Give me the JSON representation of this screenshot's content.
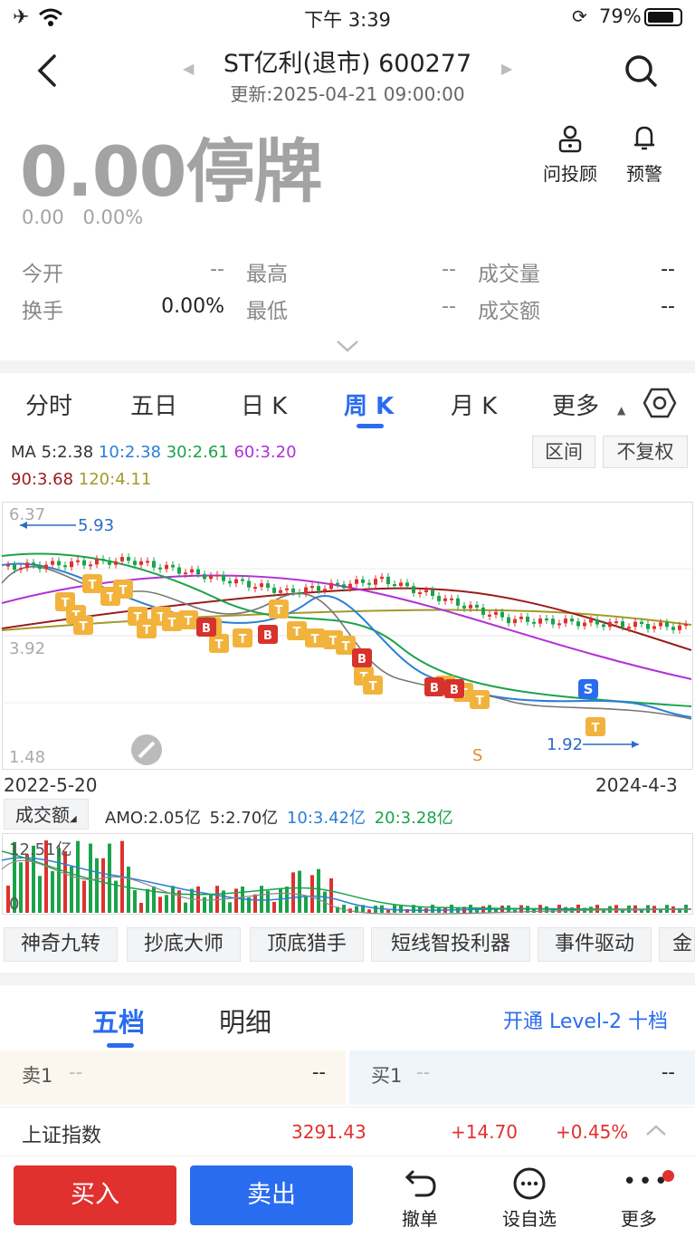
{
  "status_bar": {
    "time": "下午 3:39",
    "battery": "79%"
  },
  "header": {
    "title": "ST亿利(退市) 600277",
    "updated": "更新:2025-04-21 09:00:00"
  },
  "actions": [
    {
      "label": "问投顾"
    },
    {
      "label": "预警"
    }
  ],
  "quote": {
    "price": "0.00停牌",
    "change": "0.00",
    "change_pct": "0.00%",
    "stats": [
      {
        "label": "今开",
        "value": "--"
      },
      {
        "label": "最高",
        "value": "--"
      },
      {
        "label": "成交量",
        "value": "--"
      },
      {
        "label": "换手",
        "value": "0.00%"
      },
      {
        "label": "最低",
        "value": "--"
      },
      {
        "label": "成交额",
        "value": "--"
      }
    ]
  },
  "chart_tabs": [
    {
      "label": "分时"
    },
    {
      "label": "五日"
    },
    {
      "label": "日 K"
    },
    {
      "label": "周 K"
    },
    {
      "label": "月 K"
    },
    {
      "label": "更多"
    }
  ],
  "active_tab": "周 K",
  "ma": {
    "prefix": "MA",
    "items": [
      {
        "label": "5:2.38",
        "color": "#333333"
      },
      {
        "label": "10:2.38",
        "color": "#2a7fd4"
      },
      {
        "label": "30:2.61",
        "color": "#1aa34a"
      },
      {
        "label": "60:3.20",
        "color": "#b22fd6"
      },
      {
        "label": "90:3.68",
        "color": "#9b1c1c"
      },
      {
        "label": "120:4.11",
        "color": "#a39a2a"
      }
    ]
  },
  "chart_buttons": [
    {
      "label": "区间"
    },
    {
      "label": "不复权"
    }
  ],
  "kline": {
    "y_top": "6.37",
    "y_mid": "3.92",
    "y_bottom": "1.48",
    "high_mark": "5.93",
    "low_mark": "1.92",
    "date_start": "2022-5-20",
    "date_end": "2024-4-3",
    "s_marker": "S"
  },
  "volume": {
    "selector": "成交额",
    "amo": "AMO:2.05亿",
    "ma5": "5:2.70亿",
    "ma10": "10:3.42亿",
    "ma20": "20:3.28亿",
    "y_top": "12.51亿",
    "y_bottom": "0"
  },
  "tools": [
    {
      "label": "神奇九转"
    },
    {
      "label": "抄底大师"
    },
    {
      "label": "顶底猎手"
    },
    {
      "label": "短线智投利器"
    },
    {
      "label": "事件驱动"
    },
    {
      "label": "金"
    }
  ],
  "depth_tabs": [
    {
      "label": "五档"
    },
    {
      "label": "明细"
    }
  ],
  "level2_link": "开通 Level-2 十档",
  "order_book": {
    "sell1_label": "卖1",
    "sell1_price": "--",
    "sell1_vol": "--",
    "buy1_label": "买1",
    "buy1_price": "--",
    "buy1_vol": "--"
  },
  "index": {
    "name": "上证指数",
    "value": "3291.43",
    "change": "+14.70",
    "change_pct": "+0.45%"
  },
  "bottom": {
    "buy": "买入",
    "sell": "卖出",
    "items": [
      {
        "label": "撤单"
      },
      {
        "label": "设自选"
      },
      {
        "label": "更多"
      }
    ]
  },
  "colors": {
    "up": "#e0312f",
    "down": "#1aa34a",
    "accent": "#2a6cf0",
    "badge": "#f2b33c"
  }
}
